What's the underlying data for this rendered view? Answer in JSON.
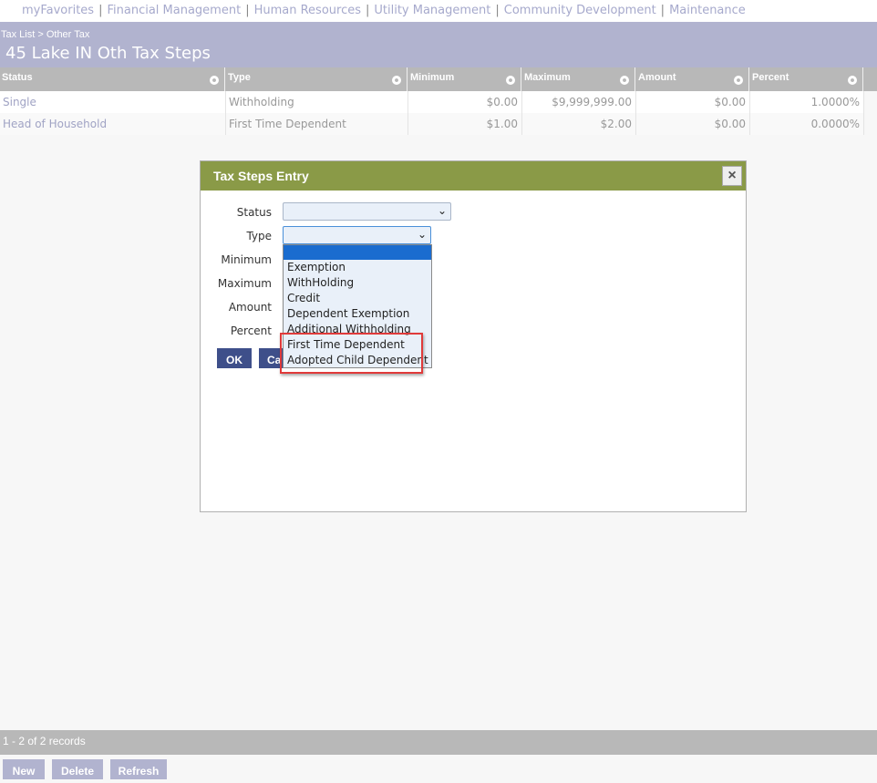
{
  "nav": {
    "items": [
      "myFavorites",
      "Financial Management",
      "Human Resources",
      "Utility Management",
      "Community Development",
      "Maintenance"
    ],
    "separator": "|"
  },
  "header": {
    "breadcrumb": "Tax List > Other Tax",
    "title": "45 Lake IN Oth Tax Steps"
  },
  "grid": {
    "columns": [
      "Status",
      "Type",
      "Minimum",
      "Maximum",
      "Amount",
      "Percent"
    ],
    "rows": [
      [
        "Single",
        "Withholding",
        "$0.00",
        "$9,999,999.00",
        "$0.00",
        "1.0000%"
      ],
      [
        "Head of Household",
        "First Time Dependent",
        "$1.00",
        "$2.00",
        "$0.00",
        "0.0000%"
      ]
    ]
  },
  "dialog": {
    "title": "Tax Steps Entry",
    "close": "×",
    "labels": {
      "status": "Status",
      "type": "Type",
      "minimum": "Minimum",
      "maximum": "Maximum",
      "amount": "Amount",
      "percent": "Percent"
    },
    "chevron": "⌄",
    "ok": "OK",
    "cancel_visible": "Ca",
    "type_options": [
      "Exemption",
      "WithHolding",
      "Credit",
      "Dependent Exemption",
      "Additional Withholding",
      "First Time Dependent",
      "Adopted Child Dependent"
    ]
  },
  "footer": {
    "record_count": "1 - 2 of 2 records",
    "new": "New",
    "delete": "Delete",
    "refresh": "Refresh"
  },
  "colors": {
    "header": "#b1b3cf",
    "dialog_header": "#8a9a47",
    "button": "#3e4f8a",
    "highlight": "#e03a3a"
  }
}
